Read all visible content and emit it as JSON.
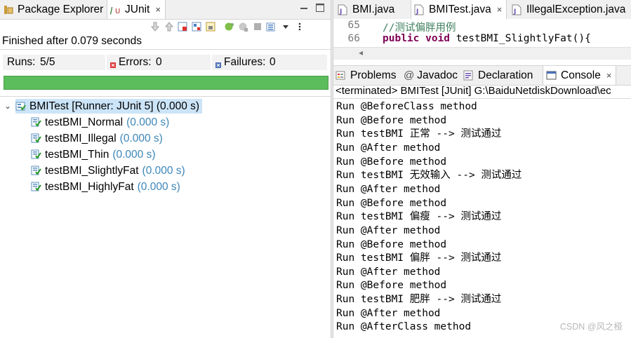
{
  "left_tabs": [
    {
      "label": "Package Explorer",
      "icon": "package-explorer-icon"
    },
    {
      "label": "JUnit",
      "icon": "junit-icon",
      "active": true,
      "close": "×"
    }
  ],
  "junit": {
    "finished": "Finished after 0.079 seconds",
    "runs_label": "Runs:",
    "runs_value": "5/5",
    "errors_label": "Errors:",
    "errors_value": "0",
    "failures_label": "Failures:",
    "failures_value": "0",
    "progress": 1.0,
    "status_color": "#5bbd5b",
    "tree": {
      "twisty": "⌄",
      "root_label": "BMITest [Runner: JUnit 5] (0.000 s)",
      "children": [
        {
          "name": "testBMI_Normal",
          "time": "(0.000 s)"
        },
        {
          "name": "testBMI_Illegal",
          "time": "(0.000 s)"
        },
        {
          "name": "testBMI_Thin",
          "time": "(0.000 s)"
        },
        {
          "name": "testBMI_SlightlyFat",
          "time": "(0.000 s)"
        },
        {
          "name": "testBMI_HighlyFat",
          "time": "(0.000 s)"
        }
      ]
    }
  },
  "editor_tabs": [
    {
      "label": "BMI.java"
    },
    {
      "label": "BMITest.java",
      "active": true,
      "close": "×"
    },
    {
      "label": "IllegalException.java"
    }
  ],
  "editor": {
    "lines": [
      {
        "num": "65",
        "comment": "//测试偏胖用例"
      },
      {
        "num": "66",
        "keyword": "public void",
        "rest": " testBMI_SlightlyFat(){"
      }
    ],
    "scroll_arrow": "◂"
  },
  "console_tabs": [
    {
      "label": "Problems",
      "icon": "problems-icon"
    },
    {
      "label": "Javadoc",
      "icon": "javadoc-icon"
    },
    {
      "label": "Declaration",
      "icon": "declaration-icon"
    },
    {
      "label": "Console",
      "icon": "console-icon",
      "active": true,
      "close": "×"
    }
  ],
  "console": {
    "status": "<terminated> BMITest [JUnit] G:\\BaiduNetdiskDownload\\ec",
    "lines": [
      "Run @BeforeClass method",
      "Run @Before method",
      "Run testBMI 正常 --> 测试通过",
      "Run @After method",
      "Run @Before method",
      "Run testBMI 无效输入 --> 测试通过",
      "Run @After method",
      "Run @Before method",
      "Run testBMI 偏瘦 --> 测试通过",
      "Run @After method",
      "Run @Before method",
      "Run testBMI 偏胖 --> 测试通过",
      "Run @After method",
      "Run @Before method",
      "Run testBMI 肥胖 --> 测试通过",
      "Run @After method",
      "Run @AfterClass method"
    ]
  },
  "watermark": "CSDN @风之桠"
}
